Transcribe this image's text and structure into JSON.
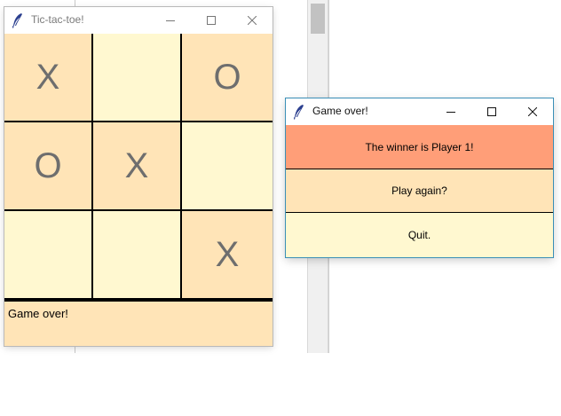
{
  "main_window": {
    "title": "Tic-tac-toe!",
    "board": [
      {
        "mark": "X",
        "shade": "dark"
      },
      {
        "mark": "",
        "shade": "light"
      },
      {
        "mark": "O",
        "shade": "dark"
      },
      {
        "mark": "O",
        "shade": "dark"
      },
      {
        "mark": "X",
        "shade": "dark"
      },
      {
        "mark": "",
        "shade": "light"
      },
      {
        "mark": "",
        "shade": "light"
      },
      {
        "mark": "",
        "shade": "light"
      },
      {
        "mark": "X",
        "shade": "dark"
      }
    ],
    "status": "Game over!"
  },
  "dialog": {
    "title": "Game over!",
    "message": "The winner is Player 1!",
    "play_again_label": "Play again?",
    "quit_label": "Quit."
  },
  "colors": {
    "cell_dark": "#ffe4b7",
    "cell_light": "#fff8d0",
    "winner_banner": "#ff9e78",
    "mark": "#6e6e6e"
  },
  "icons": [
    "feather-icon",
    "minimize-icon",
    "maximize-icon",
    "close-icon"
  ]
}
